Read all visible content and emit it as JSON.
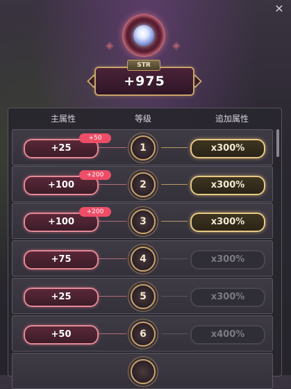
{
  "close_label": "✕",
  "header": {
    "stat_tag": "STR",
    "stat_value": "+975"
  },
  "columns": {
    "main": "主属性",
    "level": "等级",
    "bonus": "追加属性"
  },
  "rows": [
    {
      "main": "+25",
      "bonus_badge": "+50",
      "level": "1",
      "mult": "x300%",
      "active": true
    },
    {
      "main": "+100",
      "bonus_badge": "+200",
      "level": "2",
      "mult": "x300%",
      "active": true
    },
    {
      "main": "+100",
      "bonus_badge": "+200",
      "level": "3",
      "mult": "x300%",
      "active": true
    },
    {
      "main": "+75",
      "bonus_badge": "",
      "level": "4",
      "mult": "x300%",
      "active": false
    },
    {
      "main": "+25",
      "bonus_badge": "",
      "level": "5",
      "mult": "x300%",
      "active": false
    },
    {
      "main": "+50",
      "bonus_badge": "",
      "level": "6",
      "mult": "x400%",
      "active": false
    },
    {
      "main": "",
      "bonus_badge": "",
      "level": "",
      "mult": "",
      "active": false
    }
  ],
  "colors": {
    "accent_pink": "#ee4d67",
    "gold": "#e9c985"
  }
}
